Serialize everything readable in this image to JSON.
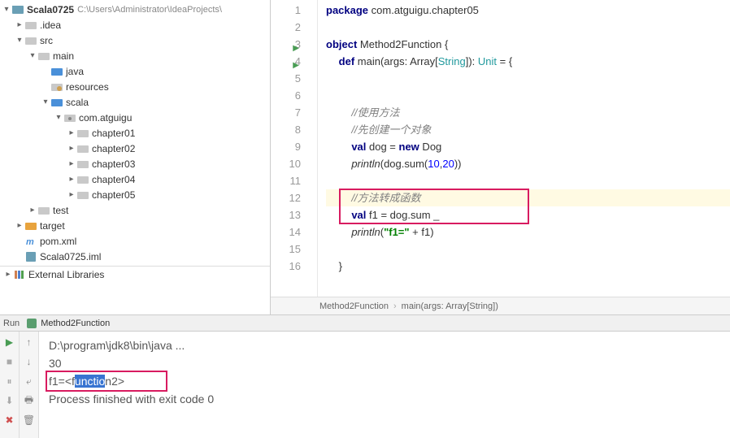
{
  "project": {
    "name": "Scala0725",
    "path": "C:\\Users\\Administrator\\IdeaProjects\\"
  },
  "tree": {
    "idea": ".idea",
    "src": "src",
    "main": "main",
    "java": "java",
    "resources": "resources",
    "scala": "scala",
    "pkg": "com.atguigu",
    "ch01": "chapter01",
    "ch02": "chapter02",
    "ch03": "chapter03",
    "ch04": "chapter04",
    "ch05": "chapter05",
    "test": "test",
    "target": "target",
    "pom": "pom.xml",
    "iml": "Scala0725.iml",
    "extlib": "External Libraries"
  },
  "code": {
    "l1": {
      "pre": "package ",
      "pkg": "com.atguigu.chapter05"
    },
    "l3": {
      "kw": "object",
      "name": " Method2Function {"
    },
    "l4": {
      "kw1": "def",
      "name": " main(args: Array[",
      "cls": "String",
      "mid": "]): ",
      "cls2": "Unit",
      "rest": " = {"
    },
    "l7": "//使用方法",
    "l8": "//先创建一个对象",
    "l9": {
      "kw": "val",
      "rest": " dog = ",
      "kw2": "new",
      "rest2": " Dog"
    },
    "l10": {
      "fn": "println",
      "rest": "(dog.sum(",
      "n1": "10",
      "c": ",",
      "n2": "20",
      "rest2": "))"
    },
    "l12": "//方法转成函数",
    "l13": {
      "kw": "val",
      "rest": " f1 = dog.sum _"
    },
    "l14": {
      "fn": "println",
      "rest": "(",
      "str": "\"f1=\"",
      "rest2": " + f1)"
    },
    "l16": "}"
  },
  "breadcrumb": {
    "p1": "Method2Function",
    "p2": "main(args: Array[String])"
  },
  "run": {
    "label": "Run",
    "tab": "Method2Function",
    "out1": "D:\\program\\jdk8\\bin\\java ...",
    "out2": "30",
    "out3a": "f1=<f",
    "out3b": "unctio",
    "out3c": "n2>",
    "out5": "Process finished with exit code 0"
  }
}
